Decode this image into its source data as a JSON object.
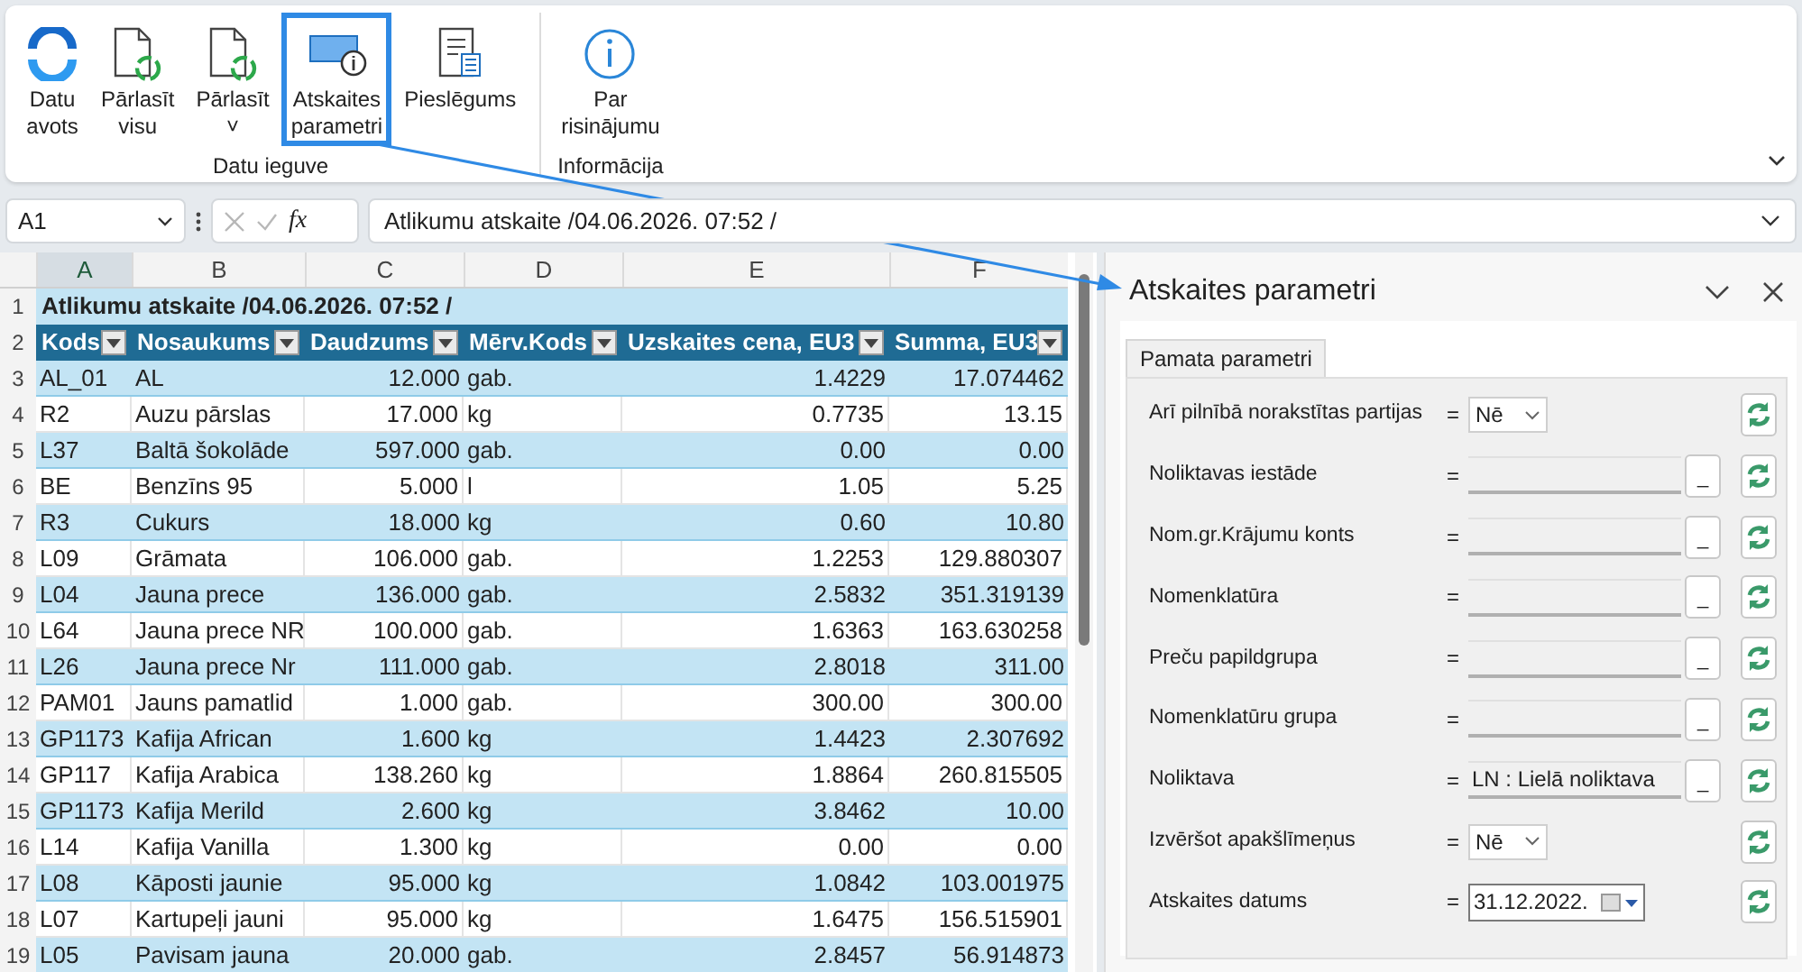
{
  "ribbon": {
    "groups": [
      {
        "label": "Datu ieguve",
        "buttons": [
          {
            "kind": "source",
            "lines": [
              "Datu",
              "avots"
            ],
            "selected": false
          },
          {
            "kind": "reload",
            "lines": [
              "Pārlasīt",
              "visu"
            ],
            "selected": false
          },
          {
            "kind": "reload",
            "lines": [
              "Pārlasīt",
              "˅"
            ],
            "selected": false
          },
          {
            "kind": "params",
            "lines": [
              "Atskaites",
              "parametri"
            ],
            "selected": true
          },
          {
            "kind": "connection",
            "lines": [
              "Pieslēgums"
            ],
            "selected": false
          }
        ]
      },
      {
        "label": "Informācija",
        "buttons": [
          {
            "kind": "info",
            "lines": [
              "Par",
              "risinājumu"
            ],
            "selected": false
          }
        ]
      }
    ]
  },
  "formula_bar": {
    "name_box": "A1",
    "fx": "fx",
    "formula": "Atlikumu atskaite /04.06.2026. 07:52 /"
  },
  "sheet": {
    "column_letters": [
      "A",
      "B",
      "C",
      "D",
      "E",
      "F"
    ],
    "title_row": {
      "number": "1",
      "text": "Atlikumu atskaite /04.06.2026. 07:52 /"
    },
    "header_row": {
      "number": "2",
      "headers": [
        "Kods",
        "Nosaukums",
        "Daudzums",
        "Mērv.Kods",
        "Uzskaites cena, EU3",
        "Summa, EU3"
      ]
    },
    "rows": [
      {
        "number": "3",
        "cells": [
          "AL_01",
          "AL",
          "12.000",
          "gab.",
          "1.4229",
          "17.074462"
        ]
      },
      {
        "number": "4",
        "cells": [
          "R2",
          "Auzu pārslas",
          "17.000",
          "kg",
          "0.7735",
          "13.15"
        ]
      },
      {
        "number": "5",
        "cells": [
          "L37",
          "Baltā šokolāde",
          "597.000",
          "gab.",
          "0.00",
          "0.00"
        ]
      },
      {
        "number": "6",
        "cells": [
          "BE",
          "Benzīns 95",
          "5.000",
          "l",
          "1.05",
          "5.25"
        ]
      },
      {
        "number": "7",
        "cells": [
          "R3",
          "Cukurs",
          "18.000",
          "kg",
          "0.60",
          "10.80"
        ]
      },
      {
        "number": "8",
        "cells": [
          "L09",
          "Grāmata",
          "106.000",
          "gab.",
          "1.2253",
          "129.880307"
        ]
      },
      {
        "number": "9",
        "cells": [
          "L04",
          "Jauna prece",
          "136.000",
          "gab.",
          "2.5832",
          "351.319139"
        ]
      },
      {
        "number": "10",
        "cells": [
          "L64",
          "Jauna prece NR",
          "100.000",
          "gab.",
          "1.6363",
          "163.630258"
        ]
      },
      {
        "number": "11",
        "cells": [
          "L26",
          "Jauna prece Nr",
          "111.000",
          "gab.",
          "2.8018",
          "311.00"
        ]
      },
      {
        "number": "12",
        "cells": [
          "PAM01",
          "Jauns pamatlid",
          "1.000",
          "gab.",
          "300.00",
          "300.00"
        ]
      },
      {
        "number": "13",
        "cells": [
          "GP1173",
          "Kafija African",
          "1.600",
          "kg",
          "1.4423",
          "2.307692"
        ]
      },
      {
        "number": "14",
        "cells": [
          "GP117",
          "Kafija Arabica",
          "138.260",
          "kg",
          "1.8864",
          "260.815505"
        ]
      },
      {
        "number": "15",
        "cells": [
          "GP1173",
          "Kafija Merild",
          "2.600",
          "kg",
          "3.8462",
          "10.00"
        ]
      },
      {
        "number": "16",
        "cells": [
          "L14",
          "Kafija Vanilla",
          "1.300",
          "kg",
          "0.00",
          "0.00"
        ]
      },
      {
        "number": "17",
        "cells": [
          "L08",
          "Kāposti jaunie",
          "95.000",
          "kg",
          "1.0842",
          "103.001975"
        ]
      },
      {
        "number": "18",
        "cells": [
          "L07",
          "Kartupeļi jauni",
          "95.000",
          "kg",
          "1.6475",
          "156.515901"
        ]
      },
      {
        "number": "19",
        "cells": [
          "L05",
          "Pavisam jauna",
          "20.000",
          "gab.",
          "2.8457",
          "56.914873"
        ]
      }
    ]
  },
  "panel": {
    "title": "Atskaites parametri",
    "tabs": [
      {
        "label": "Pamata parametri",
        "selected": true
      }
    ],
    "params": [
      {
        "kind": "dropdown",
        "label": "Arī pilnībā norakstītas partijas",
        "eq": "=",
        "value": "Nē"
      },
      {
        "kind": "lookup",
        "label": "Noliktavas iestāde",
        "eq": "=",
        "button": "_"
      },
      {
        "kind": "lookup",
        "label": "Nom.gr.Krājumu konts",
        "eq": "=",
        "button": "_"
      },
      {
        "kind": "lookup",
        "label": "Nomenklatūra",
        "eq": "=",
        "button": "_"
      },
      {
        "kind": "lookup",
        "label": "Preču papildgrupa",
        "eq": "=",
        "button": "_"
      },
      {
        "kind": "lookup",
        "label": "Nomenklatūru grupa",
        "eq": "=",
        "button": "_"
      },
      {
        "kind": "lookup",
        "label": "Noliktava",
        "eq": "=",
        "value": "LN : Lielā noliktava",
        "button": "_"
      },
      {
        "kind": "dropdown",
        "label": "Izvēršot apakšlīmeņus",
        "eq": "=",
        "value": "Nē"
      },
      {
        "kind": "date",
        "label": "Atskaites datums",
        "eq": "=",
        "value": "31.12.2022."
      }
    ]
  }
}
